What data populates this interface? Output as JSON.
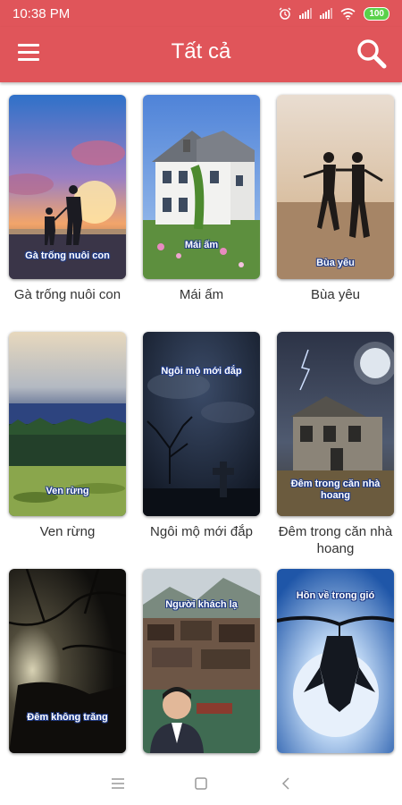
{
  "status": {
    "time": "10:38 PM",
    "battery": "100"
  },
  "appbar": {
    "title": "Tất cả"
  },
  "stories": [
    {
      "caption": "Gà trống nuôi con",
      "overlay": "Gà trống nuôi con"
    },
    {
      "caption": "Mái ấm",
      "overlay": "Mái ấm"
    },
    {
      "caption": "Bùa yêu",
      "overlay": "Bùa yêu"
    },
    {
      "caption": "Ven rừng",
      "overlay": "Ven rừng"
    },
    {
      "caption": "Ngôi mộ mới đắp",
      "overlay": "Ngôi mộ mới đắp"
    },
    {
      "caption": "Đêm trong căn nhà hoang",
      "overlay": "Đêm trong căn nhà hoang"
    },
    {
      "caption": "",
      "overlay": "Đêm không trăng"
    },
    {
      "caption": "",
      "overlay": "Người khách lạ"
    },
    {
      "caption": "",
      "overlay": "Hồn về trong gió"
    }
  ],
  "colors": {
    "accent": "#e0555a",
    "battery": "#5ad14a"
  },
  "icons": {
    "menu": "hamburger-menu-icon",
    "search": "search-icon"
  }
}
